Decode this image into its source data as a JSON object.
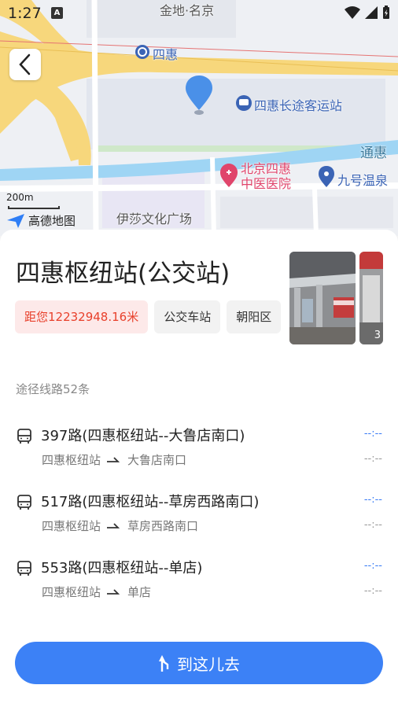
{
  "status_bar": {
    "time": "1:27",
    "notification_letter": "A"
  },
  "map": {
    "labels": {
      "jindi": "金地·名京",
      "sihui_metro": "四惠",
      "coach_station": "四惠长途客运站",
      "tonghui": "通惠",
      "hospital": "北京四惠中医医院",
      "hot_spring": "九号温泉",
      "yisha": "伊莎文化广场"
    },
    "scale": "200m",
    "logo": "高德地图"
  },
  "place": {
    "title": "四惠枢纽站(公交站)",
    "tags": {
      "distance": "距您12232948.16米",
      "type": "公交车站",
      "district": "朝阳区"
    },
    "photo_count": "3"
  },
  "routes_count": "途径线路52条",
  "routes": [
    {
      "name": "397路(四惠枢纽站--大鲁店南口)",
      "from": "四惠枢纽站",
      "to": "大鲁店南口",
      "time": "--:--",
      "sub_time": "--:--"
    },
    {
      "name": "517路(四惠枢纽站--草房西路南口)",
      "from": "四惠枢纽站",
      "to": "草房西路南口",
      "time": "--:--",
      "sub_time": "--:--"
    },
    {
      "name": "553路(四惠枢纽站--单店)",
      "from": "四惠枢纽站",
      "to": "单店",
      "time": "--:--",
      "sub_time": "--:--"
    }
  ],
  "go_button": "到这儿去",
  "colors": {
    "accent": "#3c81f6",
    "distance_text": "#e8402b",
    "distance_bg": "#fde9e9"
  }
}
